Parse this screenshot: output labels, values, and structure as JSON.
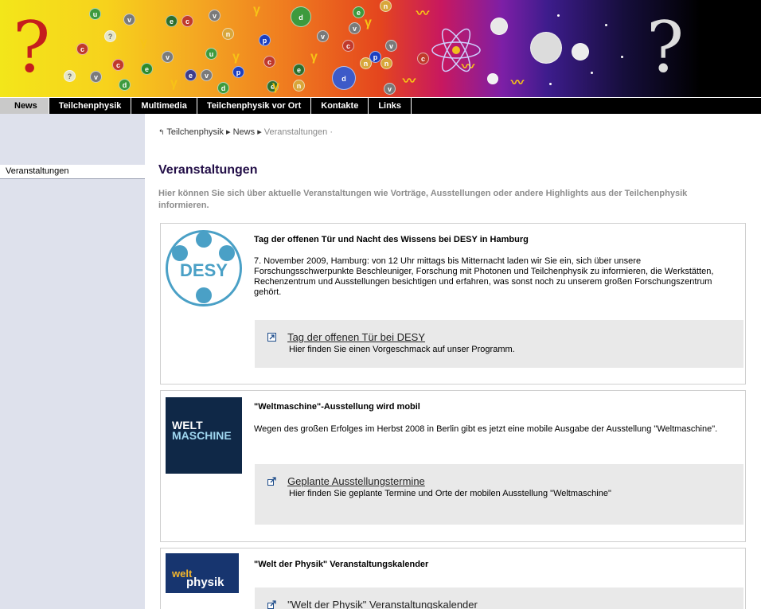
{
  "nav": {
    "items": [
      {
        "label": "News",
        "active": true
      },
      {
        "label": "Teilchenphysik",
        "active": false
      },
      {
        "label": "Multimedia",
        "active": false
      },
      {
        "label": "Teilchenphysik vor Ort",
        "active": false
      },
      {
        "label": "Kontakte",
        "active": false
      },
      {
        "label": "Links",
        "active": false
      }
    ]
  },
  "sidebar": {
    "items": [
      {
        "label": "Veranstaltungen"
      }
    ]
  },
  "breadcrumb": {
    "items": [
      "Teilchenphysik",
      "News",
      "Veranstaltungen"
    ]
  },
  "page": {
    "title": "Veranstaltungen",
    "intro": "Hier können Sie sich über aktuelle Veranstaltungen wie Vorträge, Ausstellungen oder andere Highlights aus der Teilchenphysik informieren."
  },
  "events": [
    {
      "logo_text": "DESY",
      "title": "Tag der offenen Tür und Nacht des Wissens bei DESY in Hamburg",
      "text": "7. November 2009, Hamburg: von 12 Uhr mittags bis Mitternacht laden wir Sie ein, sich über unsere Forschungsschwerpunkte Beschleuniger, Forschung mit Photonen und Teilchenphysik zu informieren, die Werkstätten, Rechenzentrum und Ausstellungen besichtigen und erfahren, was sonst noch zu unserem großen Forschungszentrum gehört.",
      "link": {
        "title": "Tag der offenen Tür bei DESY",
        "desc": "Hier finden Sie einen Vorgeschmack auf unser Programm.",
        "icon": "internal-link-icon"
      }
    },
    {
      "logo_text_1": "WELT",
      "logo_text_2": "MASCHINE",
      "title": "\"Weltmaschine\"-Ausstellung wird mobil",
      "text": "Wegen des großen Erfolges im Herbst 2008 in Berlin gibt es jetzt eine mobile Ausgabe der Ausstellung \"Weltmaschine\".",
      "link": {
        "title": "Geplante Ausstellungstermine",
        "desc": "Hier finden Sie geplante Termine und Orte der mobilen Ausstellung \"Weltmaschine\"",
        "icon": "external-link-icon"
      }
    },
    {
      "logo_text_1": "welt",
      "logo_text_2": "physik",
      "title": "\"Welt der Physik\" Veranstaltungskalender",
      "link": {
        "title": "\"Welt der Physik\" Veranstaltungskalender",
        "icon": "external-link-icon"
      }
    }
  ],
  "colors": {
    "nav_bg": "#000000",
    "nav_active": "#c9c9c9",
    "sidebar_bg": "#dee1ec",
    "title": "#220e47",
    "intro": "#8c8c8c",
    "link_box": "#e9e9e9",
    "desy_blue": "#4aa0c6"
  }
}
